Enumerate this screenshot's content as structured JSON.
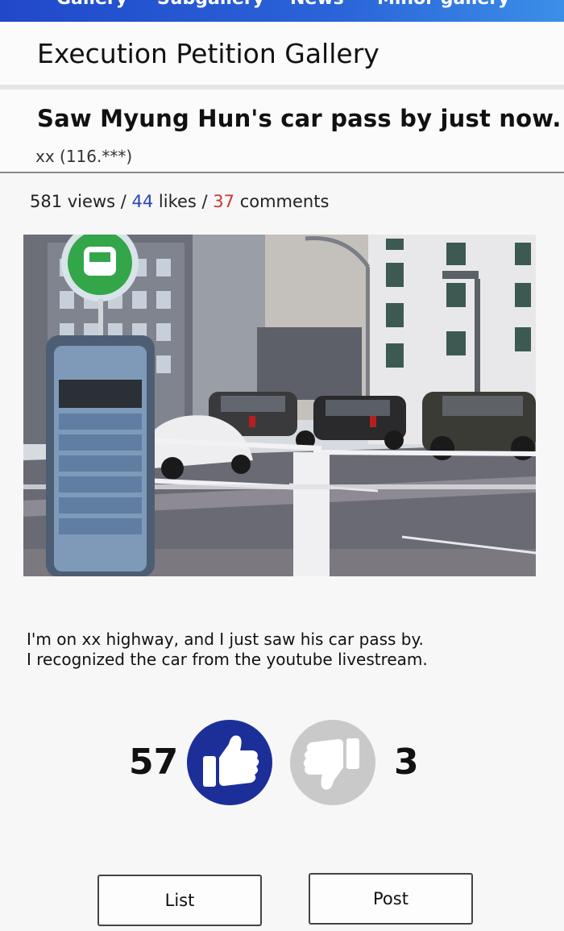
{
  "topnav": {
    "items": [
      "Gallery",
      "Subgallery",
      "News",
      "Minor gallery"
    ]
  },
  "gallery": {
    "title": "Execution Petition Gallery"
  },
  "post": {
    "title": "Saw Myung Hun's car pass by just now.",
    "author": "xx (116.***)",
    "stats": {
      "views": "581 views",
      "sep1": " / ",
      "likes_num": "44",
      "likes_label": " likes",
      "sep2": " / ",
      "comments_num": "37",
      "comments_label": " comments"
    },
    "body_lines": [
      "I'm on xx highway, and I just saw his car pass by.",
      "I recognized the car from the youtube livestream."
    ]
  },
  "votes": {
    "up": "57",
    "down": "3"
  },
  "buttons": {
    "list": "List",
    "post": "Post"
  },
  "colors": {
    "accent_blue": "#1c2f99",
    "likes": "#2a46b8",
    "comments": "#c83737",
    "nav": "#2a64d8"
  }
}
